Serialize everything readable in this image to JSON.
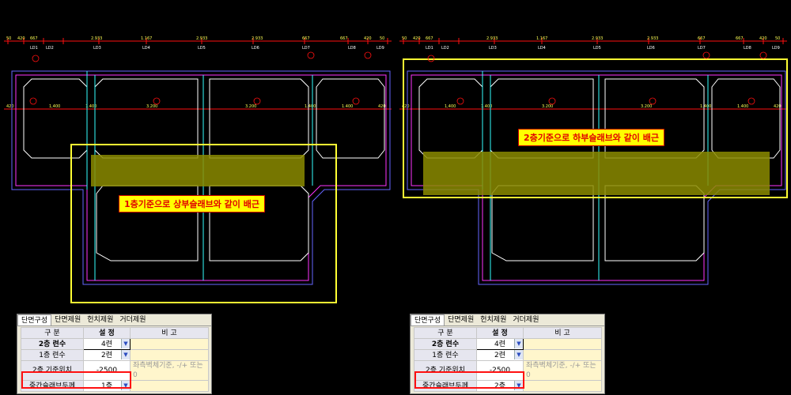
{
  "left": {
    "dim_top": [
      "50",
      "420",
      "667",
      "2.933",
      "1.167",
      "2.933",
      "667",
      "420",
      "50"
    ],
    "dim_top_tags": [
      "LD1",
      "LD2",
      "LD3",
      "LD4",
      "LD5",
      "LD6",
      "LD7",
      "LD8",
      "LD9"
    ],
    "dim_mid": [
      "420",
      "1,400",
      "1.400",
      "3.200",
      "3.200",
      "1.400",
      "1.400",
      "420"
    ],
    "note": "1층기준으로 상부슬래브와 같이 배근",
    "panel": {
      "tabs": [
        "단면구성",
        "단면제원",
        "헌치제원",
        "거더제원"
      ],
      "header": {
        "col1": "구 분",
        "col2": "설 정",
        "col3": "비 고"
      },
      "rows": [
        {
          "label": "2층 련수",
          "value": "4련",
          "remark": ""
        },
        {
          "label": "1층 련수",
          "value": "2련",
          "remark": ""
        },
        {
          "label": "2층 기준위치",
          "value": "-2500",
          "remark": "좌측벽체기준, -/+ 또는 0"
        },
        {
          "label": "중간슬래브두께",
          "value": "1층",
          "remark": ""
        }
      ]
    }
  },
  "right": {
    "dim_top": [
      "50",
      "420",
      "667",
      "2.933",
      "1.167",
      "2.933",
      "667",
      "420",
      "50"
    ],
    "dim_top_tags": [
      "LD1",
      "LD2",
      "LD3",
      "LD4",
      "LD5",
      "LD6",
      "LD7",
      "LD8",
      "LD9"
    ],
    "dim_mid": [
      "420",
      "1,400",
      "1.400",
      "3.200",
      "3.200",
      "1.400",
      "1.400",
      "420"
    ],
    "note": "2층기준으로 하부슬래브와 같이 배근",
    "panel": {
      "tabs": [
        "단면구성",
        "단면제원",
        "헌치제원",
        "거더제원"
      ],
      "header": {
        "col1": "구 분",
        "col2": "설 정",
        "col3": "비 고"
      },
      "rows": [
        {
          "label": "2층 련수",
          "value": "4련",
          "remark": ""
        },
        {
          "label": "1층 련수",
          "value": "2련",
          "remark": ""
        },
        {
          "label": "2층 기준위치",
          "value": "-2500",
          "remark": "좌측벽체기준, -/+ 또는 0"
        },
        {
          "label": "중간슬래브두께",
          "value": "2층",
          "remark": ""
        }
      ]
    }
  },
  "colors": {
    "cad_bg": "#000000",
    "slab_highlight": "#8b8b00",
    "frame_yellow": "#ffff33",
    "red": "#ff1010",
    "magenta": "#ff33ff",
    "cyan": "#33ffff",
    "blue": "#6666ff"
  }
}
